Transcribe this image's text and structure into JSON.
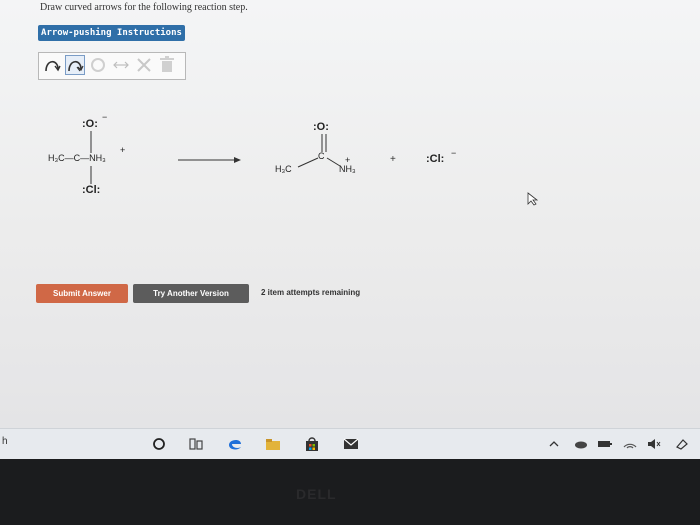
{
  "question": {
    "text": "Draw curved arrows for the following reaction step."
  },
  "instructions_button": {
    "label": "Arrow-pushing Instructions"
  },
  "toolbar": {
    "tools": [
      "curved-arrow-icon",
      "double-curved-arrow-icon",
      "ring-icon",
      "resonance-arrow-icon",
      "x-icon",
      "trash-icon"
    ]
  },
  "reaction": {
    "reactant": {
      "o_top": ":O:",
      "o_charge": "−",
      "left_group": "H₃C—C—NH₃",
      "n_charge": "+",
      "cl_bottom": ":Cl:"
    },
    "product1": {
      "o_top": ":O:",
      "c": "C",
      "left": "H₃C",
      "right": "NH₃",
      "n_charge": "+"
    },
    "plus_sign": "+",
    "product2": {
      "cl": ":Cl:",
      "charge": "−"
    }
  },
  "buttons": {
    "submit": "Submit Answer",
    "try_another": "Try Another Version"
  },
  "attempts": "2 item attempts remaining",
  "taskbar": {
    "left_label": "h",
    "icons": [
      "cortana-circle-icon",
      "task-view-icon",
      "edge-icon",
      "file-explorer-icon",
      "store-icon",
      "mail-icon"
    ],
    "tray": [
      "chevron-up-icon",
      "cloud-icon",
      "battery-icon",
      "network-icon",
      "volume-icon",
      "notification-icon"
    ]
  },
  "bezel": {
    "brand": "DELL"
  },
  "colors": {
    "accent_blue": "#2f6fa8",
    "submit_orange": "#d06846",
    "try_gray": "#5c5c5c",
    "edge_blue": "#1e6fd9"
  }
}
